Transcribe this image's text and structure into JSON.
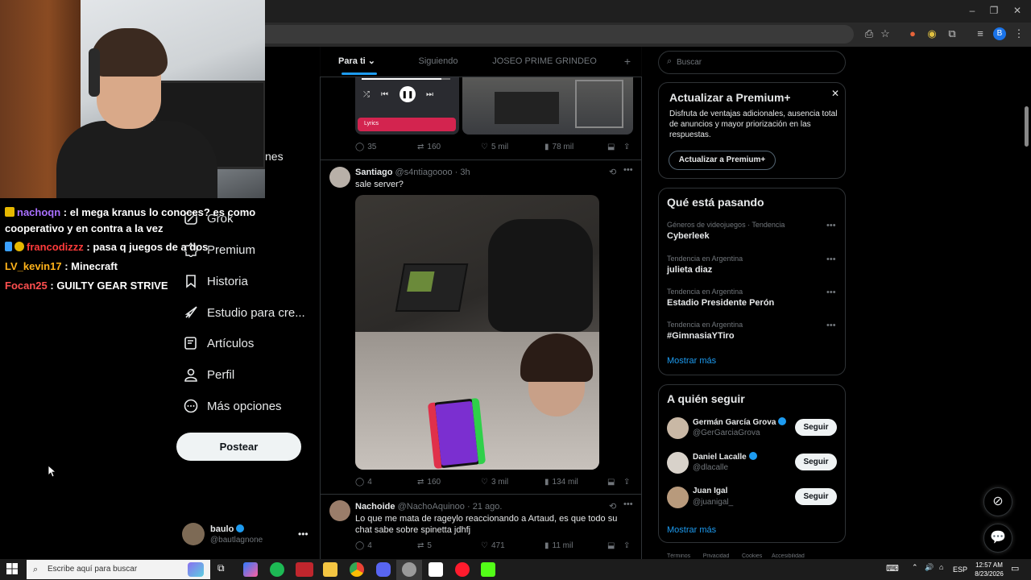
{
  "browser": {
    "window_controls": [
      "–",
      "❐",
      "✕"
    ],
    "profile_initial": "B"
  },
  "chat": [
    {
      "user": "nachoqn",
      "message": ": el mega kranus lo conoces? es como",
      "message_cont": "cooperativo y en contra a la vez"
    },
    {
      "user": "francodizzz",
      "message": ": pasa q juegos de a dos"
    },
    {
      "user": "LV_kevin17",
      "message": ": Minecraft"
    },
    {
      "user": "Focan25",
      "message": ": GUILTY GEAR STRIVE"
    }
  ],
  "sidebar": {
    "partial_label": "nes",
    "items": [
      {
        "label": "Grok",
        "icon": "grok-icon"
      },
      {
        "label": "Premium",
        "icon": "premium-icon"
      },
      {
        "label": "Historia",
        "icon": "bookmark-icon"
      },
      {
        "label": "Estudio para cre...",
        "icon": "rocket-icon"
      },
      {
        "label": "Artículos",
        "icon": "articles-icon"
      },
      {
        "label": "Perfil",
        "icon": "profile-icon"
      },
      {
        "label": "Más opciones",
        "icon": "more-icon"
      }
    ],
    "post_button": "Postear",
    "account": {
      "name": "baulo",
      "handle": "@bautlagnone"
    }
  },
  "tabs": [
    "Para ti",
    "Siguiendo",
    "JOSEO PRIME GRINDEO"
  ],
  "posts": [
    {
      "player_label": "Lyrics",
      "stats": {
        "replies": "35",
        "reposts": "160",
        "likes": "5 mil",
        "views": "78 mil"
      }
    },
    {
      "name": "Santiago",
      "handle": "@s4ntiagoooo",
      "time": "3h",
      "text": "sale server?",
      "stats": {
        "replies": "4",
        "reposts": "160",
        "likes": "3 mil",
        "views": "134 mil"
      }
    },
    {
      "name": "Nachoide",
      "handle": "@NachoAquinoo",
      "time": "21 ago.",
      "text": "Lo que me mata de rageylo reaccionando a Artaud, es que todo su chat sabe sobre spinetta jdhfj",
      "stats": {
        "replies": "4",
        "reposts": "5",
        "likes": "471",
        "views": "11 mil"
      }
    }
  ],
  "search": {
    "placeholder": "Buscar"
  },
  "premium_card": {
    "title": "Actualizar a Premium+",
    "body": "Disfruta de ventajas adicionales, ausencia total de anuncios y mayor priorización en las respuestas.",
    "button": "Actualizar a Premium+"
  },
  "trends": {
    "title": "Qué está pasando",
    "items": [
      {
        "meta": "Géneros de videojuegos · Tendencia",
        "name": "Cyberleek"
      },
      {
        "meta": "Tendencia en Argentina",
        "name": "julieta diaz"
      },
      {
        "meta": "Tendencia en Argentina",
        "name": "Estadio Presidente Perón"
      },
      {
        "meta": "Tendencia en Argentina",
        "name": "#GimnasiaYTiro"
      }
    ],
    "show_more": "Mostrar más"
  },
  "follow": {
    "title": "A quién seguir",
    "items": [
      {
        "name": "Germán García Grova",
        "handle": "@GerGarciaGrova"
      },
      {
        "name": "Daniel Lacalle",
        "handle": "@dlacalle"
      },
      {
        "name": "Juan Igal",
        "handle": "@juanigal_"
      }
    ],
    "button": "Seguir",
    "show_more": "Mostrar más"
  },
  "footer_links": [
    "Términos",
    "Privacidad",
    "Cookies",
    "Accesibilidad"
  ],
  "taskbar": {
    "search_placeholder": "Escribe aquí para buscar",
    "language": "ESP",
    "time": "12:57 AM",
    "date": "8/23/2026"
  },
  "colors": {
    "accent": "#1d9bf0",
    "background": "#000000",
    "border": "#2f3336"
  }
}
